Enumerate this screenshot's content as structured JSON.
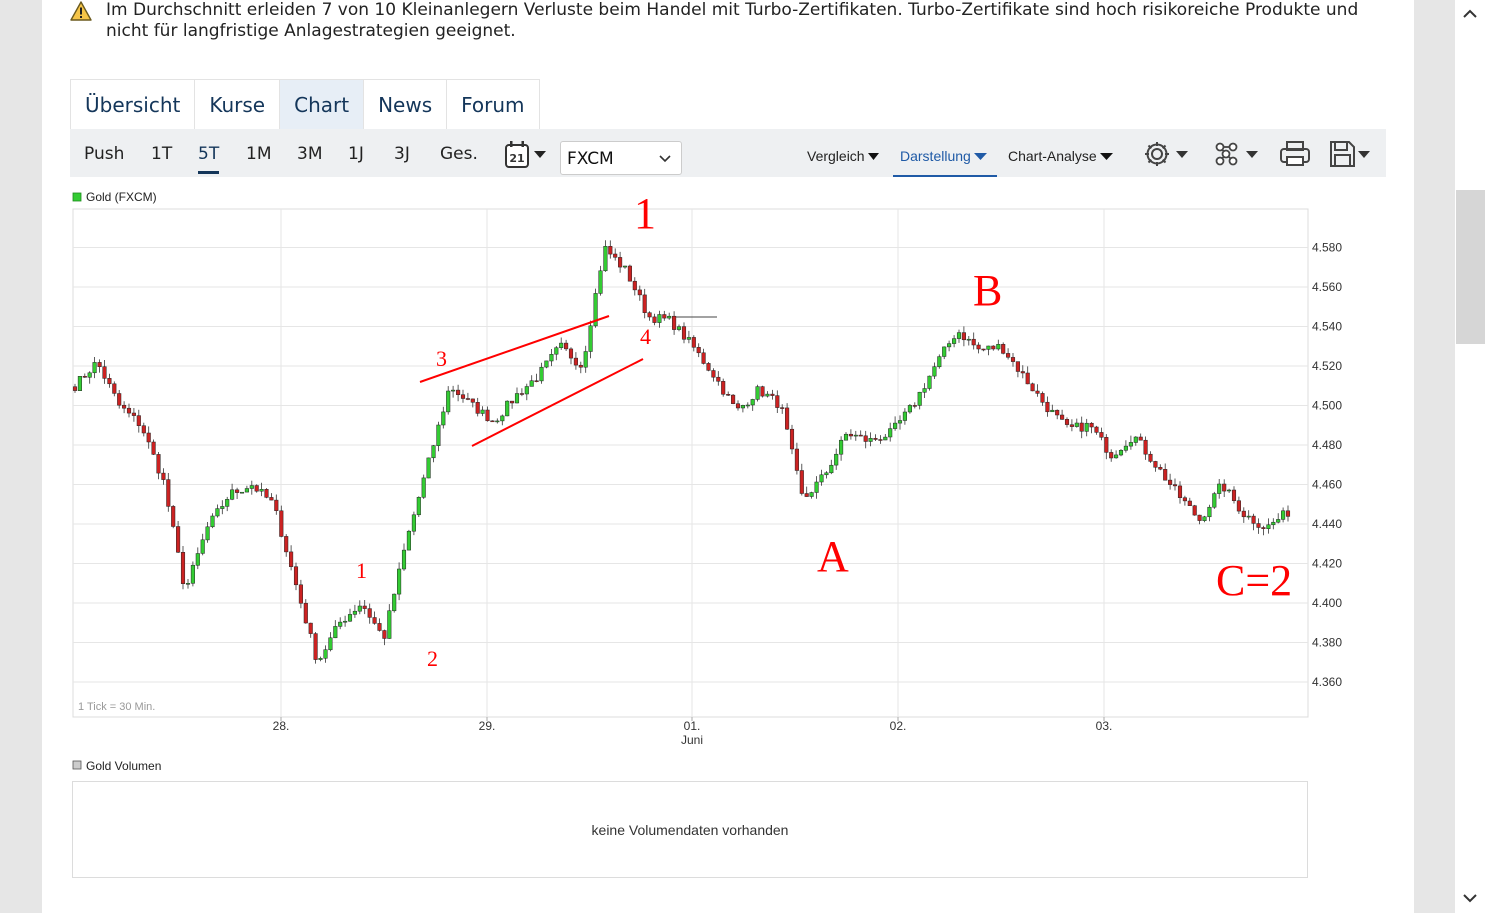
{
  "warning": {
    "icon": "warning-triangle-icon",
    "text": "Im Durchschnitt erleiden 7 von 10 Kleinanlegern Verluste beim Handel mit Turbo-Zertifikaten. Turbo-Zertifikate sind hoch risikoreiche Produkte und nicht für langfristige Anlagestrategien geeignet."
  },
  "tabs": [
    {
      "label": "Übersicht",
      "active": false
    },
    {
      "label": "Kurse",
      "active": false
    },
    {
      "label": "Chart",
      "active": true
    },
    {
      "label": "News",
      "active": false
    },
    {
      "label": "Forum",
      "active": false
    }
  ],
  "toolbar": {
    "ranges": [
      "Push",
      "1T",
      "5T",
      "1M",
      "3M",
      "1J",
      "3J",
      "Ges."
    ],
    "active_range": "5T",
    "calendar_label": "21",
    "exchange": "FXCM",
    "menus": [
      "Vergleich",
      "Darstellung",
      "Chart-Analyse"
    ],
    "active_menu": "Darstellung",
    "icons": [
      "gear-icon",
      "share-icon",
      "print-icon",
      "save-icon"
    ]
  },
  "chart": {
    "legend": "Gold (FXCM)",
    "tick_note": "1 Tick = 30 Min.",
    "volume_legend": "Gold Volumen",
    "volume_message": "keine Volumendaten vorhanden",
    "accent": "#ff0000",
    "up_color": "#33cc33",
    "down_color": "#cc2222",
    "annotations": [
      {
        "text": "1",
        "big": true
      },
      {
        "text": "B",
        "big": true
      },
      {
        "text": "A",
        "big": true
      },
      {
        "text": "C=2",
        "big": true
      },
      {
        "text": "1",
        "big": false
      },
      {
        "text": "2",
        "big": false
      },
      {
        "text": "3",
        "big": false
      },
      {
        "text": "4",
        "big": false
      }
    ]
  },
  "chart_data": {
    "type": "candlestick",
    "title": "Gold (FXCM)",
    "xlabel": "",
    "ylabel": "",
    "ylim": [
      4352,
      4608
    ],
    "y_ticks": [
      4360,
      4380,
      4400,
      4420,
      4440,
      4460,
      4480,
      4500,
      4520,
      4540,
      4560,
      4580
    ],
    "x_ticks": [
      "28.",
      "29.",
      "01.",
      "02.",
      "03."
    ],
    "x_tick_sublabel": {
      "01.": "Juni"
    },
    "grid": true,
    "interval": "30 Min.",
    "series": [
      {
        "name": "Gold (FXCM)",
        "trend_path": [
          {
            "t": "27.05.",
            "price": 4510
          },
          {
            "t": "27.05.",
            "price": 4522
          },
          {
            "t": "27.05.",
            "price": 4500
          },
          {
            "t": "27.05.",
            "price": 4490
          },
          {
            "t": "27.05.",
            "price": 4462
          },
          {
            "t": "27.05.",
            "price": 4406
          },
          {
            "t": "27.05.",
            "price": 4438
          },
          {
            "t": "27.05.",
            "price": 4455
          },
          {
            "t": "28.",
            "price": 4460
          },
          {
            "t": "28.",
            "price": 4450
          },
          {
            "t": "28.",
            "price": 4410
          },
          {
            "t": "28.",
            "price": 4370
          },
          {
            "t": "28.",
            "price": 4390
          },
          {
            "t": "28.",
            "price": 4400
          },
          {
            "t": "28.",
            "price": 4382
          },
          {
            "t": "28.",
            "price": 4430
          },
          {
            "t": "28.",
            "price": 4470
          },
          {
            "t": "28.",
            "price": 4510
          },
          {
            "t": "29.",
            "price": 4500
          },
          {
            "t": "29.",
            "price": 4492
          },
          {
            "t": "29.",
            "price": 4505
          },
          {
            "t": "29.",
            "price": 4515
          },
          {
            "t": "29.",
            "price": 4530
          },
          {
            "t": "29.",
            "price": 4520
          },
          {
            "t": "29.",
            "price": 4580
          },
          {
            "t": "29.",
            "price": 4568
          },
          {
            "t": "29.",
            "price": 4545
          },
          {
            "t": "01.",
            "price": 4543
          },
          {
            "t": "01.",
            "price": 4530
          },
          {
            "t": "01.",
            "price": 4515
          },
          {
            "t": "01.",
            "price": 4497
          },
          {
            "t": "01.",
            "price": 4508
          },
          {
            "t": "01.",
            "price": 4500
          },
          {
            "t": "01.",
            "price": 4452
          },
          {
            "t": "01.",
            "price": 4465
          },
          {
            "t": "01.",
            "price": 4486
          },
          {
            "t": "02.",
            "price": 4482
          },
          {
            "t": "02.",
            "price": 4486
          },
          {
            "t": "02.",
            "price": 4500
          },
          {
            "t": "02.",
            "price": 4520
          },
          {
            "t": "02.",
            "price": 4538
          },
          {
            "t": "02.",
            "price": 4528
          },
          {
            "t": "02.",
            "price": 4530
          },
          {
            "t": "02.",
            "price": 4515
          },
          {
            "t": "02.",
            "price": 4500
          },
          {
            "t": "02.",
            "price": 4488
          },
          {
            "t": "03.",
            "price": 4490
          },
          {
            "t": "03.",
            "price": 4475
          },
          {
            "t": "03.",
            "price": 4485
          },
          {
            "t": "03.",
            "price": 4470
          },
          {
            "t": "03.",
            "price": 4455
          },
          {
            "t": "03.",
            "price": 4442
          },
          {
            "t": "03.",
            "price": 4460
          },
          {
            "t": "03.",
            "price": 4445
          },
          {
            "t": "03.",
            "price": 4438
          },
          {
            "t": "03.",
            "price": 4446
          }
        ]
      }
    ],
    "annotations": [
      "1",
      "B",
      "A",
      "C=2",
      "1",
      "2",
      "3",
      "4"
    ]
  }
}
